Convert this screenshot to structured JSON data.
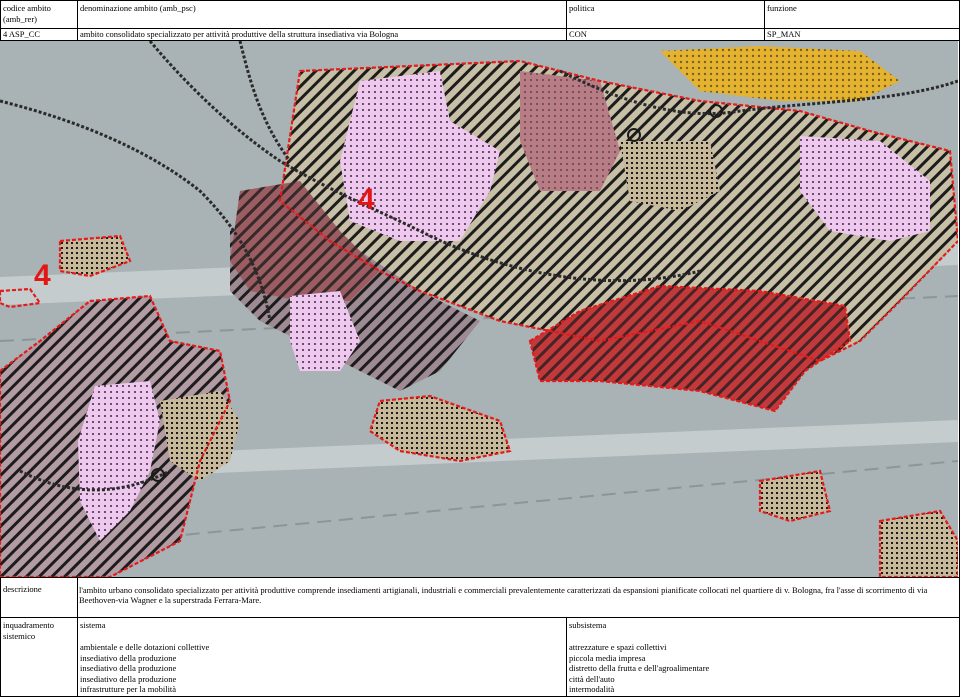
{
  "header": {
    "codice_label": [
      "codice ambito",
      "(amb_rer)"
    ],
    "denominazione_label": "denominazione ambito (amb_psc)",
    "politica_label": "politica",
    "funzione_label": "funzione",
    "codice_value": "4 ASP_CC",
    "denominazione_value": "ambito consolidato specializzato per attività produttive della struttura insediativa via Bologna",
    "politica_value": "CON",
    "funzione_value": "SP_MAN"
  },
  "map": {
    "labels": [
      "4",
      "4"
    ],
    "colors": {
      "background": "#a9b2b4",
      "pink": "#eec8ee",
      "red": "#c23b3b",
      "dark_red": "#9a5a5e",
      "mauve": "#b89aa4",
      "tan": "#c8b89a",
      "yellow": "#e6b32e",
      "border_red": "#e41b1b",
      "label_red": "#e31515"
    }
  },
  "descrizione": {
    "label": "descrizione",
    "text": "l'ambito urbano consolidato specializzato per attività produttive comprende insediamenti artigianali, industriali e commerciali prevalentemente caratterizzati da espansioni pianificate collocati nel quartiere di v. Bologna, fra l'asse di scorrimento di via Beethoven-via Wagner e la superstrada Ferrara-Mare."
  },
  "inquadramento": {
    "label": [
      "inquadramento",
      "sistemico"
    ],
    "sistema_header": "sistema",
    "subsistema_header": "subsistema",
    "sistema_rows": [
      "ambientale e delle dotazioni collettive",
      "insediativo della produzione",
      "insediativo della produzione",
      "insediativo della produzione",
      "infrastrutture per la mobilità"
    ],
    "subsistema_rows": [
      "attrezzature e spazi collettivi",
      "piccola media impresa",
      "distretto della frutta e dell'agroalimentare",
      "città dell'auto",
      "intermodalità"
    ]
  }
}
